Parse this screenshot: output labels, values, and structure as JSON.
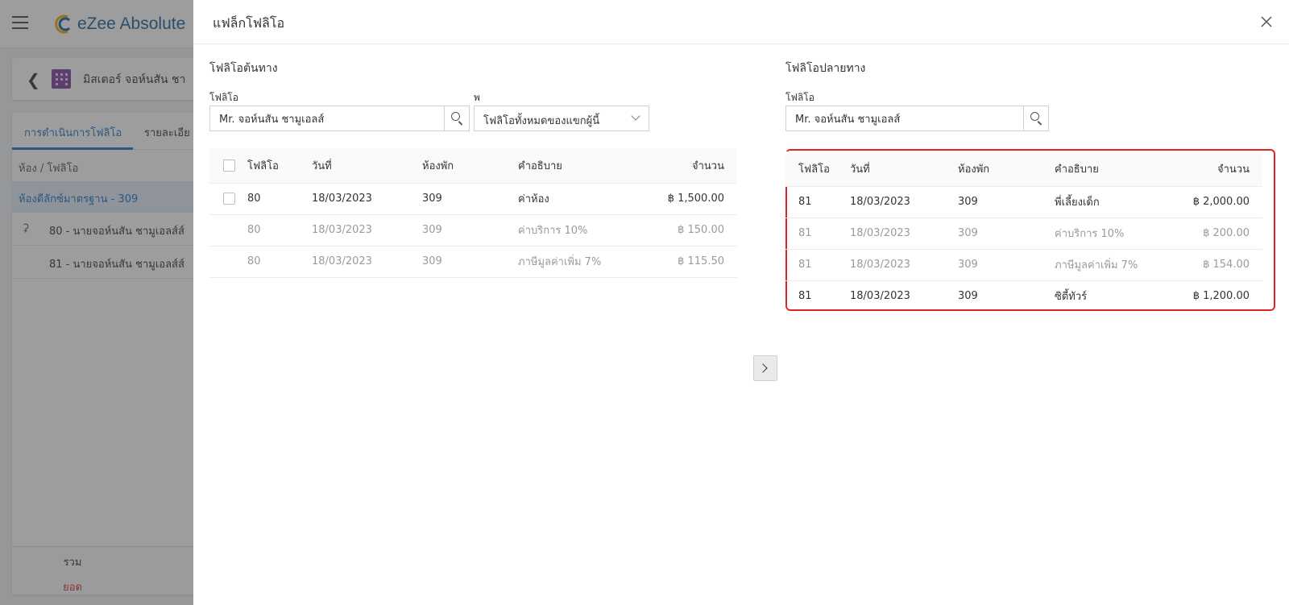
{
  "app": {
    "logo_text": "eZee Absolute",
    "guest_card_title": "มิสเตอร์ จอห์นสัน ชา",
    "tabs": [
      "การดำเนินการโฟลิโอ",
      "รายละเอีย"
    ],
    "column_header": "ห้อง / โฟลิโอ",
    "selected_room": "ห้องดีลักซ์มาตรฐาน - 309",
    "folios": [
      "80 - นายจอห์นสัน ชามูเอลส์ส์",
      "81 - นายจอห์นสัน ชามูเอลส์ส์"
    ],
    "footer_total": "รวม",
    "footer_balance": "ยอด"
  },
  "drawer": {
    "title": "แฟล็กโฟลิโอ",
    "source": {
      "title": "โฟลิโอต้นทาง",
      "folio_label": "โฟลิโอ",
      "folio_value": "Mr. จอห์นสัน ชามูเอลส์",
      "filter_label": "พ",
      "filter_value": "โฟลิโอทั้งหมดของแขกผู้นี้",
      "columns": [
        "โฟลิโอ",
        "วันที่",
        "ห้องพัก",
        "คำอธิบาย",
        "จำนวน"
      ],
      "rows": [
        {
          "folio": "80",
          "date": "18/03/2023",
          "room": "309",
          "desc": "ค่าห้อง",
          "amount": "฿ 1,500.00"
        },
        {
          "folio": "80",
          "date": "18/03/2023",
          "room": "309",
          "desc": "ค่าบริการ 10%",
          "amount": "฿ 150.00"
        },
        {
          "folio": "80",
          "date": "18/03/2023",
          "room": "309",
          "desc": "ภาษีมูลค่าเพิ่ม 7%",
          "amount": "฿ 115.50"
        }
      ]
    },
    "destination": {
      "title": "โฟลิโอปลายทาง",
      "folio_label": "โฟลิโอ",
      "folio_value": "Mr. จอห์นสัน ชามูเอลส์",
      "columns": [
        "โฟลิโอ",
        "วันที่",
        "ห้องพัก",
        "คำอธิบาย",
        "จำนวน"
      ],
      "rows": [
        {
          "folio": "81",
          "date": "18/03/2023",
          "room": "309",
          "desc": "พี่เลี้ยงเด็ก",
          "amount": "฿ 2,000.00"
        },
        {
          "folio": "81",
          "date": "18/03/2023",
          "room": "309",
          "desc": "ค่าบริการ 10%",
          "amount": "฿ 200.00"
        },
        {
          "folio": "81",
          "date": "18/03/2023",
          "room": "309",
          "desc": "ภาษีมูลค่าเพิ่ม 7%",
          "amount": "฿ 154.00"
        },
        {
          "folio": "81",
          "date": "18/03/2023",
          "room": "309",
          "desc": "ซิตี้ทัวร์",
          "amount": "฿ 1,200.00"
        }
      ]
    }
  },
  "icons": {
    "menu": "hamburger-icon",
    "close": "close-icon",
    "search": "search-icon",
    "move": "chevron-right-icon"
  },
  "colors": {
    "accent": "#1b73c9",
    "highlight_outline": "#e02424",
    "building_icon": "#7b3fa0"
  }
}
